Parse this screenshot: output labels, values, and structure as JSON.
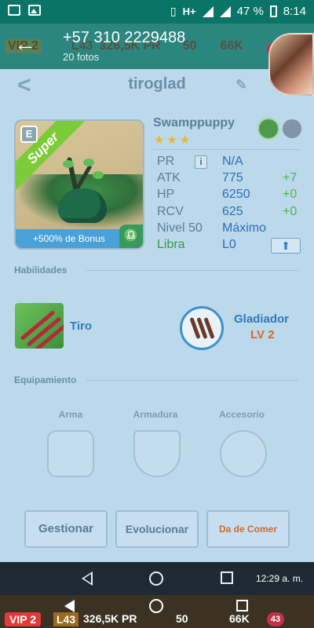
{
  "status_bar": {
    "network": "H+",
    "battery": "47 %",
    "time": "8:14"
  },
  "viewer_header": {
    "contact": "+57 310 2229488",
    "subtitle": "20 fotos",
    "ghost_vip": "VIP 2",
    "ghost_level": "L43",
    "ghost_pr": "326,5K PR",
    "ghost_energy": "50",
    "ghost_coins": "66K",
    "ghost_badge": "43"
  },
  "page": {
    "title": "tiroglad"
  },
  "card": {
    "rarity": "Super",
    "type_letter": "E",
    "bonus": "+500% de Bonus",
    "libra_symbol": "♎"
  },
  "monster": {
    "name": "Swamppuppy",
    "stars": [
      "★",
      "★",
      "★"
    ],
    "elements": [
      "leaf",
      "rock"
    ]
  },
  "stats": {
    "pr": {
      "label": "PR",
      "value": "N/A",
      "info": "i"
    },
    "atk": {
      "label": "ATK",
      "value": "775",
      "plus": "+7"
    },
    "hp": {
      "label": "HP",
      "value": "6250",
      "plus": "+0"
    },
    "rcv": {
      "label": "RCV",
      "value": "625",
      "plus": "+0"
    },
    "level": {
      "label": "Nivel 50",
      "value": "Máximo"
    },
    "libra": {
      "label": "Libra",
      "value": "L0",
      "up": "⬆"
    }
  },
  "abilities": {
    "section_title": "Habilidades",
    "skill1": "Tiro",
    "skill2": "Gladiador",
    "skill2_level": "LV 2"
  },
  "equipment": {
    "section_title": "Equipamiento",
    "slots": [
      "Arma",
      "Armadura",
      "Accesorio"
    ]
  },
  "actions": {
    "manage": "Gestionar",
    "evolve": "Evolucionar",
    "feed": "Da de Comer"
  },
  "nav": {
    "time": "12:29 a. m."
  },
  "bottom_strip": {
    "vip": "VIP 2",
    "level": "L43",
    "pr": "326,5K PR",
    "energy": "50",
    "coins": "66K",
    "badge": "43"
  },
  "colors": {
    "status_bar": "#0b7468",
    "page_bg": "#bcd9ec",
    "feed_button_text": "#d06a2a",
    "stat_value": "#2f6fb3",
    "stat_bonus": "#56b34a"
  }
}
